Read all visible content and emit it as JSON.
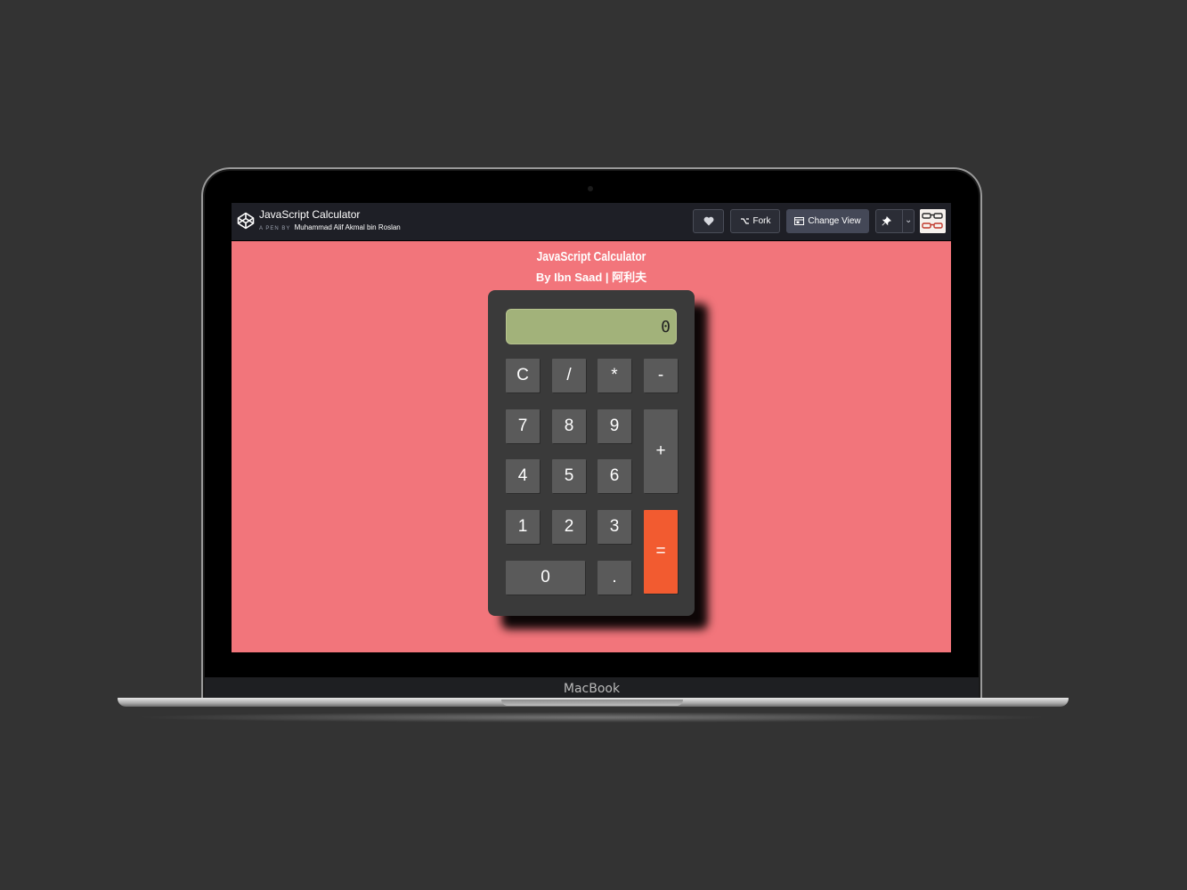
{
  "device": {
    "brand_label": "MacBook"
  },
  "codepen": {
    "pen_title": "JavaScript Calculator",
    "pen_by_prefix": "A PEN BY",
    "author": "Muhammad Alif Akmal bin Roslan",
    "buttons": {
      "fork": "Fork",
      "change_view": "Change View"
    },
    "icons": [
      "codepen-logo-icon",
      "heart-icon",
      "fork-icon",
      "layout-icon",
      "pin-icon",
      "chevron-down-icon"
    ]
  },
  "page": {
    "title": "JavaScript Calculator",
    "subtitle": "By Ibn Saad | 阿利夫",
    "background_color": "#f2757b"
  },
  "calculator": {
    "display_value": "0",
    "keys": {
      "clear": "C",
      "divide": "/",
      "multiply": "*",
      "subtract": "-",
      "seven": "7",
      "eight": "8",
      "nine": "9",
      "add": "+",
      "four": "4",
      "five": "5",
      "six": "6",
      "one": "1",
      "two": "2",
      "three": "3",
      "equals": "=",
      "zero": "0",
      "decimal": "."
    },
    "equals_color": "#f25b30",
    "display_color": "#a2b27a"
  }
}
